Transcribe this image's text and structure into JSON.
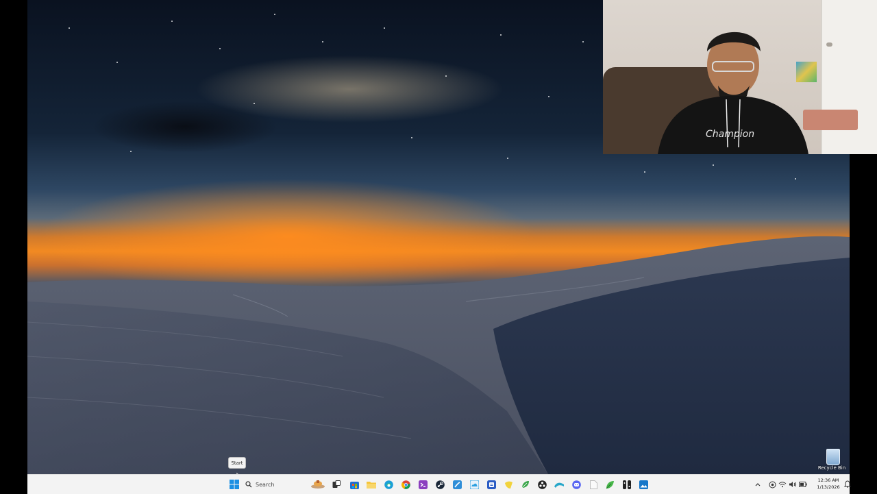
{
  "desktop": {
    "recycle_bin_label": "Recycle Bin",
    "start_tooltip": "Start"
  },
  "taskbar": {
    "search_placeholder": "Search",
    "pinned_apps": [
      {
        "name": "start-button",
        "icon": "windows-logo-icon",
        "color": "#1a8fe3"
      },
      {
        "name": "widgets-button",
        "icon": "weather-widget-icon",
        "color": "#e8a54b"
      },
      {
        "name": "task-view-button",
        "icon": "task-view-icon",
        "color": "#333333"
      },
      {
        "name": "app-store",
        "icon": "store-icon",
        "color": "#1f6fd1"
      },
      {
        "name": "app-file-explorer",
        "icon": "folder-icon",
        "color": "#f5c53a"
      },
      {
        "name": "app-edge",
        "icon": "edge-icon",
        "color": "#1b9fd8"
      },
      {
        "name": "app-chrome",
        "icon": "chrome-icon",
        "color": "#db4437"
      },
      {
        "name": "app-visual-studio",
        "icon": "visual-studio-icon",
        "color": "#8b3fbf"
      },
      {
        "name": "app-steam",
        "icon": "steam-icon",
        "color": "#1b2838"
      },
      {
        "name": "app-paint",
        "icon": "paint-icon",
        "color": "#2f8ed8"
      },
      {
        "name": "app-cloud",
        "icon": "cloud-app-icon",
        "color": "#2da0e0"
      },
      {
        "name": "app-notes",
        "icon": "notes-app-icon",
        "color": "#2b5cc4"
      },
      {
        "name": "app-sticky-notes",
        "icon": "sticky-notes-icon",
        "color": "#f2d33c"
      },
      {
        "name": "app-leaf",
        "icon": "leaf-icon",
        "color": "#3aa64a"
      },
      {
        "name": "app-obs",
        "icon": "obs-icon",
        "color": "#222222"
      },
      {
        "name": "app-wave",
        "icon": "wave-icon",
        "color": "#27a7c9"
      },
      {
        "name": "app-discord",
        "icon": "discord-icon",
        "color": "#5865f2"
      },
      {
        "name": "app-document",
        "icon": "document-icon",
        "color": "#dddddd"
      },
      {
        "name": "app-green-leaf",
        "icon": "green-leaf-icon",
        "color": "#47b649"
      },
      {
        "name": "app-switch",
        "icon": "switch-icon",
        "color": "#222222"
      },
      {
        "name": "app-photos",
        "icon": "photos-icon",
        "color": "#1677c9"
      }
    ]
  },
  "tray": {
    "chevron_icon": "chevron-up-icon",
    "icons": [
      "security-icon",
      "wifi-icon",
      "volume-icon",
      "battery-icon"
    ],
    "time": "12:36 AM",
    "date": "1/13/2026"
  }
}
